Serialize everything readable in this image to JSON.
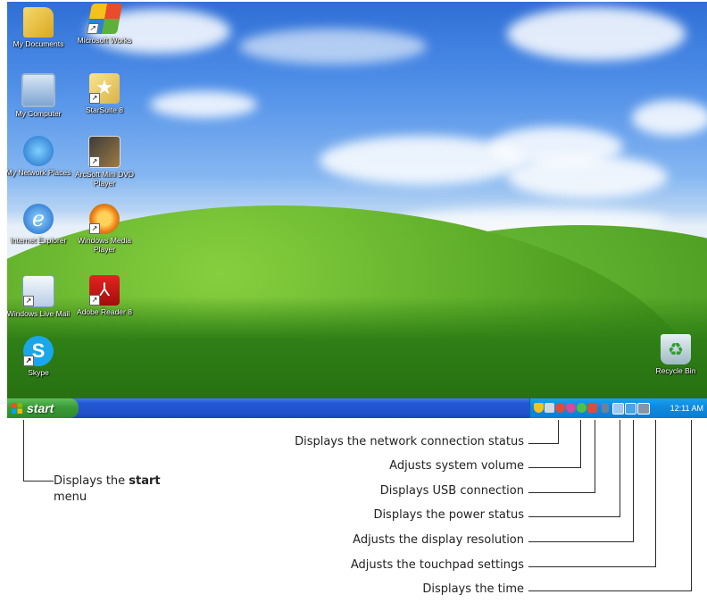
{
  "desktop": {
    "icons": [
      {
        "label": "My Documents",
        "icon": "my-documents-icon"
      },
      {
        "label": "Microsoft Works",
        "icon": "microsoft-works-icon"
      },
      {
        "label": "My Computer",
        "icon": "my-computer-icon"
      },
      {
        "label": "StarSuite 8",
        "icon": "starsuite-icon"
      },
      {
        "label": "My Network Places",
        "icon": "network-places-icon"
      },
      {
        "label": "ArcSoft Mini DVD Player",
        "icon": "dvd-player-icon"
      },
      {
        "label": "Internet Explorer",
        "icon": "internet-explorer-icon"
      },
      {
        "label": "Windows Media Player",
        "icon": "media-player-icon"
      },
      {
        "label": "Windows Live Mail",
        "icon": "live-mail-icon"
      },
      {
        "label": "Adobe Reader 8",
        "icon": "adobe-reader-icon"
      },
      {
        "label": "Skype",
        "icon": "skype-icon"
      },
      {
        "label": "Recycle Bin",
        "icon": "recycle-bin-icon"
      }
    ]
  },
  "taskbar": {
    "start_label": "start",
    "clock": "12:11 AM"
  },
  "callouts": {
    "network": "Displays the network connection status",
    "volume": "Adjusts system volume",
    "usb": "Displays USB connection",
    "power": "Displays the power status",
    "resolution": "Adjusts the display resolution",
    "touchpad": "Adjusts the touchpad settings",
    "time": "Displays the time",
    "start_prefix": "Displays the ",
    "start_bold": "start",
    "start_suffix": "menu"
  },
  "colors": {
    "taskbar": "#2457d3",
    "start_button": "#3a9a36",
    "tray": "#0f8bdf",
    "leader_line": "#2a2a2a"
  }
}
